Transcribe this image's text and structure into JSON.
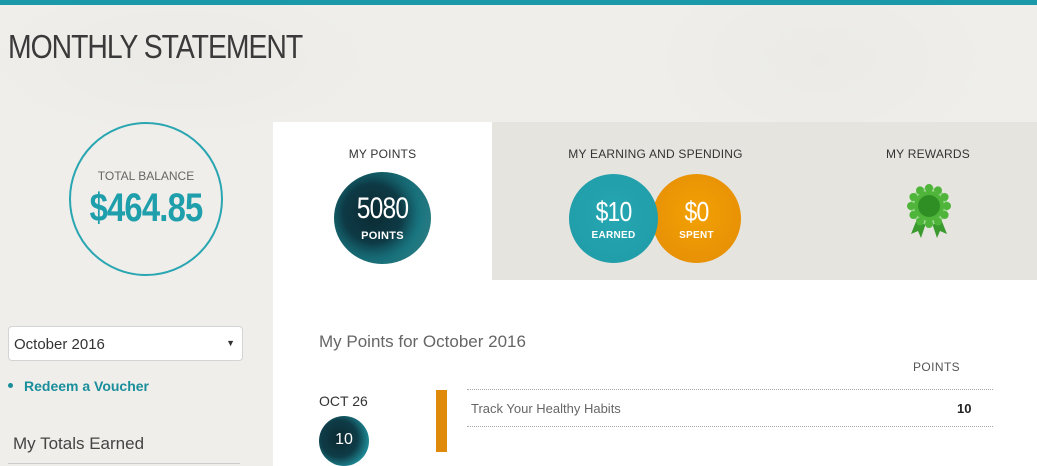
{
  "page": {
    "title": "MONTHLY STATEMENT"
  },
  "colors": {
    "accent": "#1a9aa8",
    "earned": "#1e9aa6",
    "spent": "#e89508",
    "entry_bar": "#e08a0c",
    "award": "#3cae2e"
  },
  "balance": {
    "label": "TOTAL BALANCE",
    "amount": "$464.85"
  },
  "month_select": {
    "value": "October 2016",
    "caret": "▼"
  },
  "sidebar": {
    "redeem_link": "Redeem a Voucher",
    "totals_heading": "My Totals Earned"
  },
  "tabs": {
    "points": {
      "label": "MY POINTS",
      "value": "5080",
      "unit": "POINTS"
    },
    "earning": {
      "label": "MY EARNING AND SPENDING",
      "earned_value": "$10",
      "earned_unit": "EARNED",
      "spent_value": "$0",
      "spent_unit": "SPENT"
    },
    "rewards": {
      "label": "MY REWARDS",
      "icon": "award-ribbon-icon"
    }
  },
  "main": {
    "heading": "My Points for October 2016",
    "column_header": "POINTS",
    "entries": [
      {
        "date": "OCT 26",
        "day_points": "10",
        "title": "Track Your Healthy Habits",
        "points": "10"
      }
    ]
  }
}
